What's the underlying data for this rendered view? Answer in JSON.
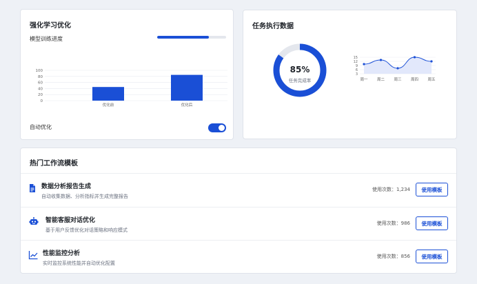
{
  "rl_card": {
    "title": "强化学习优化",
    "progress_label": "模型训练进度",
    "progress": 0.75,
    "auto_label": "自动优化",
    "auto_enabled": true
  },
  "task_card": {
    "title": "任务执行数据",
    "donut_value": "85%",
    "donut_percent": 85,
    "donut_caption": "任务完成率"
  },
  "template_card": {
    "title": "热门工作流模板",
    "items": [
      {
        "icon": "document-icon",
        "name": "数据分析报告生成",
        "desc": "自动收集数据、分析指标并生成完整报告",
        "usage": "使用次数：1,234",
        "button": "使用模板"
      },
      {
        "icon": "robot-icon",
        "name": "智能客服对话优化",
        "desc": "基于用户反馈优化对话策略和响应模式",
        "usage": "使用次数：986",
        "button": "使用模板"
      },
      {
        "icon": "line-chart-icon",
        "name": "性能监控分析",
        "desc": "实时监控系统性能并自动优化配置",
        "usage": "使用次数：856",
        "button": "使用模板"
      }
    ]
  },
  "colors": {
    "accent": "#1a4fd6",
    "area": "#dfe6fb",
    "track": "#e4e7ed"
  },
  "chart_data": [
    {
      "type": "bar",
      "categories": [
        "优化前",
        "优化后"
      ],
      "values": [
        45,
        85
      ],
      "yticks": [
        0,
        20,
        40,
        60,
        80,
        100
      ],
      "ylim": [
        0,
        100
      ],
      "grid": true
    },
    {
      "type": "area",
      "categories": [
        "周一",
        "周二",
        "周三",
        "周四",
        "周五"
      ],
      "values": [
        10,
        13,
        7,
        15,
        12
      ],
      "yticks": [
        3,
        6,
        9,
        12,
        15
      ],
      "ylim": [
        3,
        15
      ],
      "grid": true
    }
  ]
}
